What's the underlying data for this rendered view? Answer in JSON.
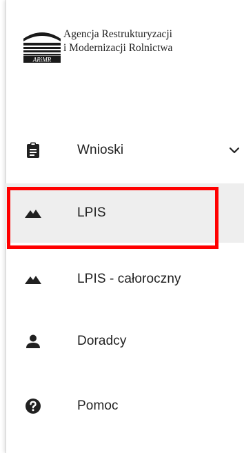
{
  "logo": {
    "line1": "Agencja Restrukturyzacji",
    "line2": "i Modernizacji Rolnictwa",
    "mark_text": "ARiMR"
  },
  "menu": {
    "items": [
      {
        "label": "Wnioski",
        "icon": "clipboard-icon",
        "expandable": true
      },
      {
        "label": "LPIS",
        "icon": "mountain-icon",
        "selected": true
      },
      {
        "label": "LPIS - całoroczny",
        "icon": "mountain-icon"
      },
      {
        "label": "Doradcy",
        "icon": "person-icon"
      },
      {
        "label": "Pomoc",
        "icon": "help-circle-icon"
      }
    ]
  },
  "colors": {
    "highlight_border": "#ff0000",
    "selected_background": "#eeeeee",
    "icon": "#212121"
  }
}
